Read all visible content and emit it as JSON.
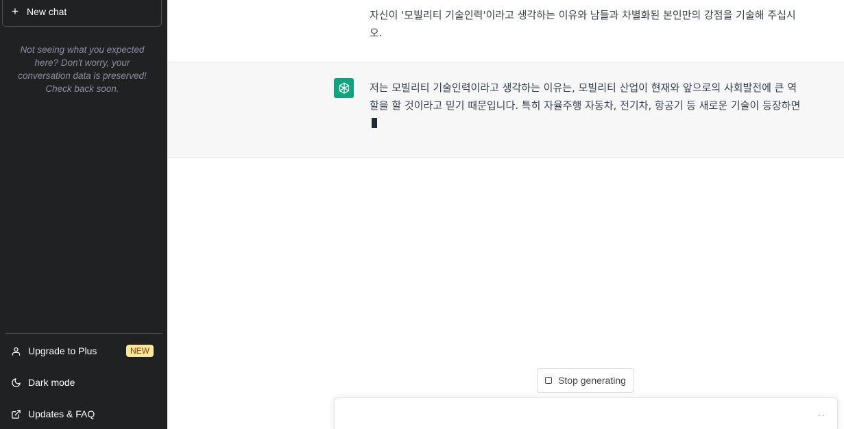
{
  "sidebar": {
    "new_chat_label": "New chat",
    "notice": "Not seeing what you expected here? Don't worry, your conversation data is preserved! Check back soon.",
    "items": [
      {
        "label": "Upgrade to Plus",
        "icon": "user-icon",
        "badge": "NEW"
      },
      {
        "label": "Dark mode",
        "icon": "moon-icon"
      },
      {
        "label": "Updates & FAQ",
        "icon": "external-link-icon"
      }
    ]
  },
  "conversation": {
    "user_message": "자신이 '모빌리티 기술인력'이라고 생각하는 이유와 남들과 차별화된 본인만의 강점을 기술해 주십시오.",
    "assistant_message": "저는 모빌리티 기술인력이라고 생각하는 이유는, 모빌리티 산업이 현재와 앞으로의 사회발전에 큰 역할을 할 것이라고 믿기 때문입니다. 특히 자율주행 자동차, 전기차, 항공기 등 새로운 기술이 등장하면"
  },
  "controls": {
    "stop_label": "Stop generating",
    "input_placeholder": "",
    "typing_indicator": "··"
  },
  "colors": {
    "sidebar_bg": "#202123",
    "accent": "#10a37f",
    "badge_bg": "#fae69e"
  }
}
